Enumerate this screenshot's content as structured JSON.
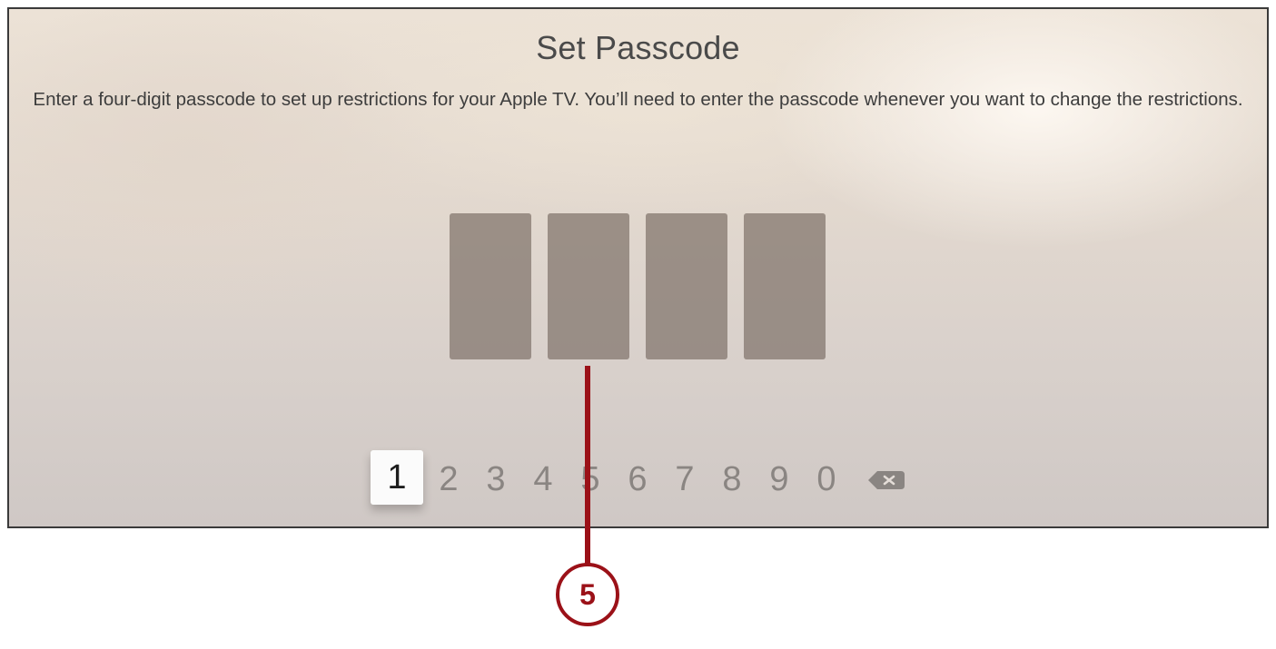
{
  "screen": {
    "title": "Set Passcode",
    "description": "Enter a four-digit passcode to set up restrictions for your Apple TV. You’ll need to enter the passcode whenever you want to change the restrictions."
  },
  "passcode": {
    "digit_count": 4,
    "entered_digits": 0
  },
  "keypad": {
    "keys": [
      "1",
      "2",
      "3",
      "4",
      "5",
      "6",
      "7",
      "8",
      "9",
      "0"
    ],
    "selected_key": "1",
    "backspace_icon": "backspace-icon"
  },
  "callout": {
    "number": "5",
    "color": "#9b1118"
  }
}
